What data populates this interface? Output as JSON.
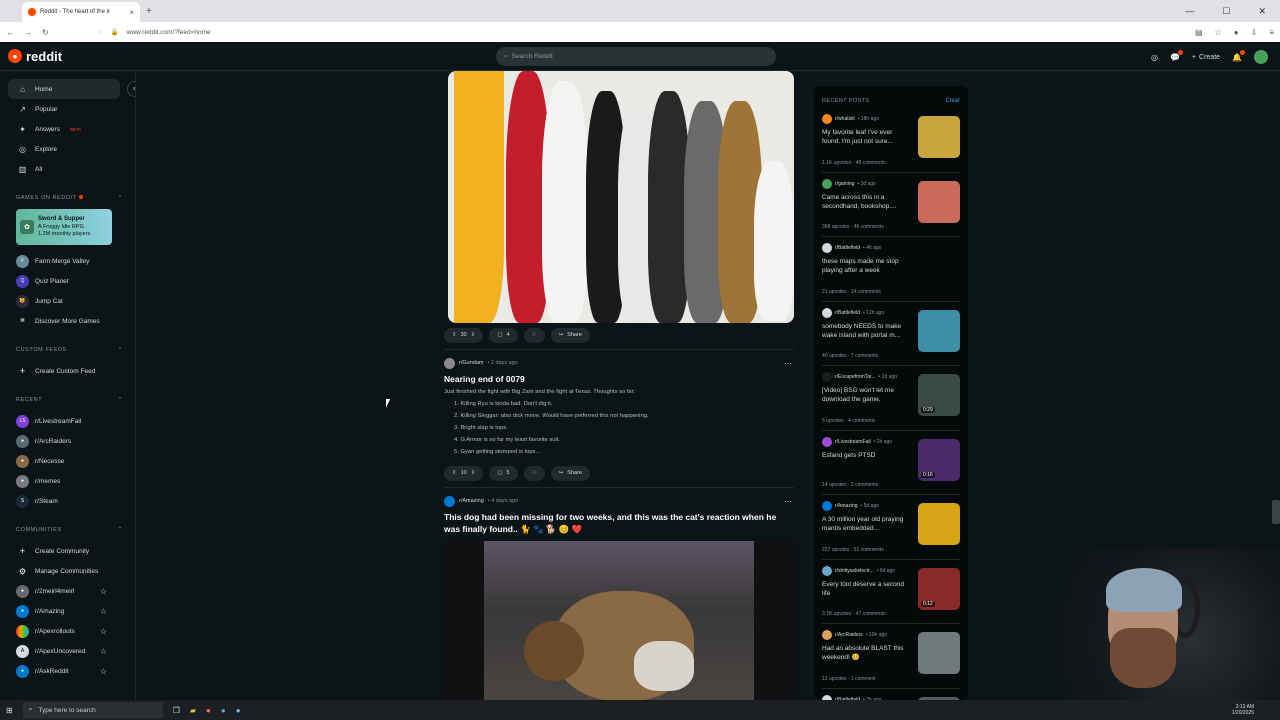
{
  "browser": {
    "tab_title": "Reddit - The heart of the ir",
    "url": "www.reddit.com/?feed=home",
    "new_tab": "+",
    "win_min": "—",
    "win_max": "☐",
    "win_close": "✕"
  },
  "header": {
    "logo_text": "reddit",
    "search_placeholder": "Search Reddit",
    "create_label": "Create"
  },
  "sidebar": {
    "nav": [
      {
        "label": "Home",
        "icon": "home-icon"
      },
      {
        "label": "Popular",
        "icon": "popular-icon"
      },
      {
        "label": "Answers",
        "badge": "BETA",
        "icon": "answers-icon"
      },
      {
        "label": "Explore",
        "icon": "explore-icon"
      },
      {
        "label": "All",
        "icon": "all-icon"
      }
    ],
    "games_header": "GAMES ON REDDIT",
    "game_card": {
      "title": "Sword & Supper",
      "subtitle": "A Froggy Idle RPG",
      "players": "1.2M monthly players"
    },
    "games": [
      "Farm Merge Valley",
      "Quiz Planet",
      "Jump Cat",
      "Discover More Games"
    ],
    "custom_feeds_header": "CUSTOM FEEDS",
    "create_custom_feed": "Create Custom Feed",
    "recent_header": "RECENT",
    "recent": [
      "r/LivestreamFail",
      "r/ArcRaiders",
      "r/Necesse",
      "r/memes",
      "r/Steam"
    ],
    "communities_header": "COMMUNITIES",
    "create_community": "Create Community",
    "manage_communities": "Manage Communities",
    "communities": [
      "r/2meirl4meirl",
      "r/Amazing",
      "r/Apexrollouts",
      "r/ApexUncovered",
      "r/AskReddit"
    ]
  },
  "feed": {
    "post1": {
      "votes": "30",
      "comments": "4",
      "share": "Share"
    },
    "post2": {
      "subreddit": "r/Gundam",
      "time": "• 2 days ago",
      "title": "Nearing end of 0079",
      "body": "Just finished the fight with Big Zam and the fight at Texas. Thoughts so far:",
      "list": [
        "1. Killing Ryu is kinda bad. Don't dig it.",
        "2. Killing Sleggar: also dick move. Would have preferred this not happening.",
        "3. Bright slap is tops.",
        "4. G Armor is so far my least favorite suit.",
        "5. Gyan getting stomped is tops...."
      ],
      "votes": "10",
      "comments": "5",
      "share": "Share"
    },
    "post3": {
      "subreddit": "r/Amazing",
      "time": "• 4 days ago",
      "title": "This dog had been missing for two weeks, and this was the cat's reaction when he was finally found.. 🐈 🐾 🐕 😊 ❤️"
    }
  },
  "recent_posts": {
    "header": "RECENT POSTS",
    "clear": "Clear",
    "items": [
      {
        "sub": "r/whatisit",
        "time": "• 18h ago",
        "title": "My favorite leaf I've ever found. I'm just not sure...",
        "stats": "1.1K upvotes  ·  48 comments",
        "thumb_color": "#c9a63b",
        "av_color": "#ff8717"
      },
      {
        "sub": "r/gaming",
        "time": "• 3d ago",
        "title": "Came across this in a secondhand, bookshop....",
        "stats": "358 upvotes  ·  46 comments",
        "thumb_color": "#c96a5a",
        "av_color": "#46a15d"
      },
      {
        "sub": "r/Battlefield",
        "time": "• 4h ago",
        "title": "these maps made me stop playing after a week",
        "stats": "21 upvotes  ·  14 comments",
        "av_color": "#d7dadc"
      },
      {
        "sub": "r/Battlefield",
        "time": "• 12h ago",
        "title": "somebody NEEDS to make wake island with portal m...",
        "stats": "40 upvotes  ·  7 comments",
        "thumb_color": "#3c8fa6",
        "av_color": "#d7dadc"
      },
      {
        "sub": "r/EscapefromTar...",
        "time": "• 2d ago",
        "title": "[Video] BSG won't let me download the game.",
        "stats": "5 upvotes  ·  4 comments",
        "thumb_color": "#3b4a46",
        "duration": "0:29",
        "av_color": "#1c1c1c"
      },
      {
        "sub": "r/LivestreamFail",
        "time": "• 2h ago",
        "title": "Esfand gets PTSD",
        "stats": "14 upvotes  ·  2 comments",
        "thumb_color": "#4a2a6a",
        "duration": "0:16",
        "av_color": "#a04ad8"
      },
      {
        "sub": "r/Amazing",
        "time": "• 5d ago",
        "title": "A 30 million year old praying mantis embedded...",
        "stats": "227 upvotes  ·  51 comments",
        "thumb_color": "#d8a418",
        "av_color": "#0079d3"
      },
      {
        "sub": "r/shittyaskelectr...",
        "time": "• 6d ago",
        "title": "Every tool deserve a second life",
        "stats": "3.7K upvotes  ·  47 comments",
        "thumb_color": "#8a2a2a",
        "duration": "0:12",
        "av_color": "#6aa8c8"
      },
      {
        "sub": "r/ArcRaiders",
        "time": "• 10h ago",
        "title": "Had an absolute BLAST this weekend! 😊",
        "stats": "12 upvotes  ·  1 comment",
        "thumb_color": "#6f7a7d",
        "av_color": "#e0a060"
      },
      {
        "sub": "r/Battlefield",
        "time": "• 2h ago",
        "title": "",
        "stats": "",
        "thumb_color": "#5a5a5a",
        "av_color": "#d7dadc"
      }
    ]
  },
  "taskbar": {
    "search_placeholder": "Type here to search",
    "time": "3:13 AM",
    "date": "1/20/2025"
  }
}
